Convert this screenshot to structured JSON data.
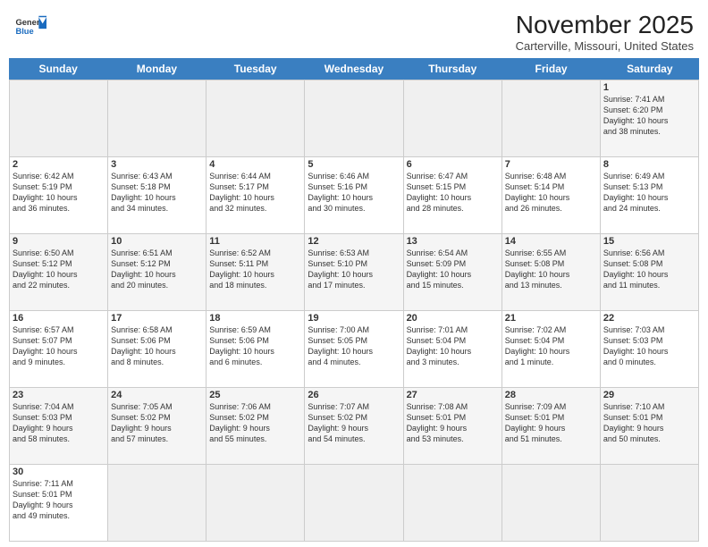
{
  "header": {
    "logo_text_general": "General",
    "logo_text_blue": "Blue",
    "month_title": "November 2025",
    "location": "Carterville, Missouri, United States"
  },
  "weekdays": [
    "Sunday",
    "Monday",
    "Tuesday",
    "Wednesday",
    "Thursday",
    "Friday",
    "Saturday"
  ],
  "weeks": [
    [
      {
        "day": "",
        "empty": true
      },
      {
        "day": "",
        "empty": true
      },
      {
        "day": "",
        "empty": true
      },
      {
        "day": "",
        "empty": true
      },
      {
        "day": "",
        "empty": true
      },
      {
        "day": "",
        "empty": true
      },
      {
        "day": "1",
        "text": "Sunrise: 7:41 AM\nSunset: 6:20 PM\nDaylight: 10 hours\nand 38 minutes."
      }
    ],
    [
      {
        "day": "2",
        "text": "Sunrise: 6:42 AM\nSunset: 5:19 PM\nDaylight: 10 hours\nand 36 minutes."
      },
      {
        "day": "3",
        "text": "Sunrise: 6:43 AM\nSunset: 5:18 PM\nDaylight: 10 hours\nand 34 minutes."
      },
      {
        "day": "4",
        "text": "Sunrise: 6:44 AM\nSunset: 5:17 PM\nDaylight: 10 hours\nand 32 minutes."
      },
      {
        "day": "5",
        "text": "Sunrise: 6:46 AM\nSunset: 5:16 PM\nDaylight: 10 hours\nand 30 minutes."
      },
      {
        "day": "6",
        "text": "Sunrise: 6:47 AM\nSunset: 5:15 PM\nDaylight: 10 hours\nand 28 minutes."
      },
      {
        "day": "7",
        "text": "Sunrise: 6:48 AM\nSunset: 5:14 PM\nDaylight: 10 hours\nand 26 minutes."
      },
      {
        "day": "8",
        "text": "Sunrise: 6:49 AM\nSunset: 5:13 PM\nDaylight: 10 hours\nand 24 minutes."
      }
    ],
    [
      {
        "day": "9",
        "text": "Sunrise: 6:50 AM\nSunset: 5:12 PM\nDaylight: 10 hours\nand 22 minutes."
      },
      {
        "day": "10",
        "text": "Sunrise: 6:51 AM\nSunset: 5:12 PM\nDaylight: 10 hours\nand 20 minutes."
      },
      {
        "day": "11",
        "text": "Sunrise: 6:52 AM\nSunset: 5:11 PM\nDaylight: 10 hours\nand 18 minutes."
      },
      {
        "day": "12",
        "text": "Sunrise: 6:53 AM\nSunset: 5:10 PM\nDaylight: 10 hours\nand 17 minutes."
      },
      {
        "day": "13",
        "text": "Sunrise: 6:54 AM\nSunset: 5:09 PM\nDaylight: 10 hours\nand 15 minutes."
      },
      {
        "day": "14",
        "text": "Sunrise: 6:55 AM\nSunset: 5:08 PM\nDaylight: 10 hours\nand 13 minutes."
      },
      {
        "day": "15",
        "text": "Sunrise: 6:56 AM\nSunset: 5:08 PM\nDaylight: 10 hours\nand 11 minutes."
      }
    ],
    [
      {
        "day": "16",
        "text": "Sunrise: 6:57 AM\nSunset: 5:07 PM\nDaylight: 10 hours\nand 9 minutes."
      },
      {
        "day": "17",
        "text": "Sunrise: 6:58 AM\nSunset: 5:06 PM\nDaylight: 10 hours\nand 8 minutes."
      },
      {
        "day": "18",
        "text": "Sunrise: 6:59 AM\nSunset: 5:06 PM\nDaylight: 10 hours\nand 6 minutes."
      },
      {
        "day": "19",
        "text": "Sunrise: 7:00 AM\nSunset: 5:05 PM\nDaylight: 10 hours\nand 4 minutes."
      },
      {
        "day": "20",
        "text": "Sunrise: 7:01 AM\nSunset: 5:04 PM\nDaylight: 10 hours\nand 3 minutes."
      },
      {
        "day": "21",
        "text": "Sunrise: 7:02 AM\nSunset: 5:04 PM\nDaylight: 10 hours\nand 1 minute."
      },
      {
        "day": "22",
        "text": "Sunrise: 7:03 AM\nSunset: 5:03 PM\nDaylight: 10 hours\nand 0 minutes."
      }
    ],
    [
      {
        "day": "23",
        "text": "Sunrise: 7:04 AM\nSunset: 5:03 PM\nDaylight: 9 hours\nand 58 minutes."
      },
      {
        "day": "24",
        "text": "Sunrise: 7:05 AM\nSunset: 5:02 PM\nDaylight: 9 hours\nand 57 minutes."
      },
      {
        "day": "25",
        "text": "Sunrise: 7:06 AM\nSunset: 5:02 PM\nDaylight: 9 hours\nand 55 minutes."
      },
      {
        "day": "26",
        "text": "Sunrise: 7:07 AM\nSunset: 5:02 PM\nDaylight: 9 hours\nand 54 minutes."
      },
      {
        "day": "27",
        "text": "Sunrise: 7:08 AM\nSunset: 5:01 PM\nDaylight: 9 hours\nand 53 minutes."
      },
      {
        "day": "28",
        "text": "Sunrise: 7:09 AM\nSunset: 5:01 PM\nDaylight: 9 hours\nand 51 minutes."
      },
      {
        "day": "29",
        "text": "Sunrise: 7:10 AM\nSunset: 5:01 PM\nDaylight: 9 hours\nand 50 minutes."
      }
    ],
    [
      {
        "day": "30",
        "text": "Sunrise: 7:11 AM\nSunset: 5:01 PM\nDaylight: 9 hours\nand 49 minutes."
      },
      {
        "day": "",
        "empty": true
      },
      {
        "day": "",
        "empty": true
      },
      {
        "day": "",
        "empty": true
      },
      {
        "day": "",
        "empty": true
      },
      {
        "day": "",
        "empty": true
      },
      {
        "day": "",
        "empty": true
      }
    ]
  ]
}
